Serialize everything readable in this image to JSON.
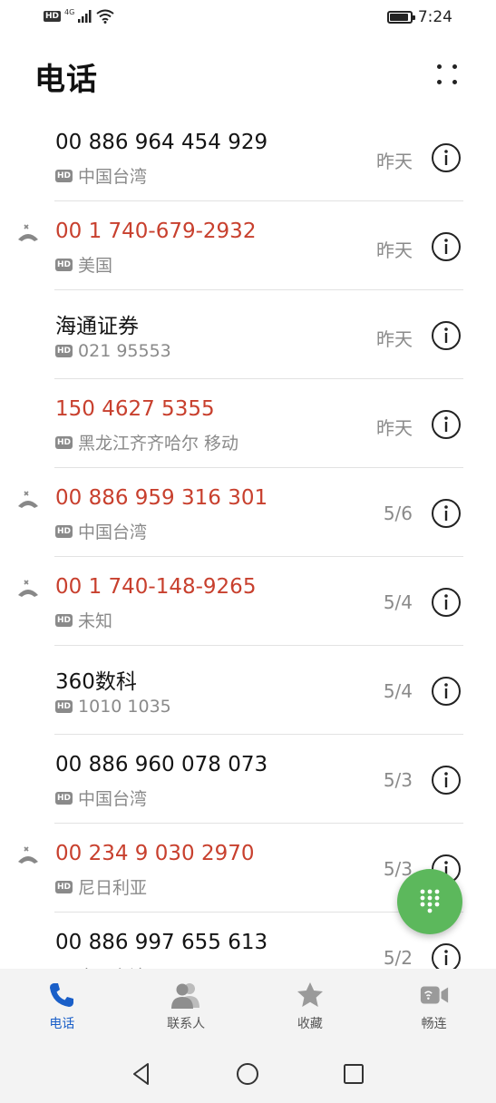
{
  "status_bar": {
    "hd": "HD",
    "network": "4G",
    "time": "7:24",
    "battery_level": 0.9
  },
  "header": {
    "title": "电话"
  },
  "calls": [
    {
      "name": "00 886 964 454 929",
      "location": "中国台湾",
      "date": "昨天",
      "missed": false
    },
    {
      "name": "00 1 740-679-2932",
      "location": "美国",
      "date": "昨天",
      "missed": true
    },
    {
      "name": "海通证券",
      "location": "021 95553",
      "date": "昨天",
      "missed": false
    },
    {
      "name": "150 4627 5355",
      "location": "黑龙江齐齐哈尔 移动",
      "date": "昨天",
      "missed": true
    },
    {
      "name": "00 886 959 316 301",
      "location": "中国台湾",
      "date": "5/6",
      "missed": true
    },
    {
      "name": "00 1 740-148-9265",
      "location": "未知",
      "date": "5/4",
      "missed": true
    },
    {
      "name": "360数科",
      "location": "1010 1035",
      "date": "5/4",
      "missed": false
    },
    {
      "name": "00 886 960 078 073",
      "location": "中国台湾",
      "date": "5/3",
      "missed": false
    },
    {
      "name": "00 234 9 030 2970",
      "location": "尼日利亚",
      "date": "5/3",
      "missed": true
    },
    {
      "name": "00 886 997 655 613",
      "location": "中国台湾",
      "date": "5/2",
      "missed": false
    }
  ],
  "hd_label": "HD",
  "bottom_nav": [
    {
      "label": "电话",
      "icon": "phone-icon",
      "active": true
    },
    {
      "label": "联系人",
      "icon": "contacts-icon",
      "active": false
    },
    {
      "label": "收藏",
      "icon": "star-icon",
      "active": false
    },
    {
      "label": "畅连",
      "icon": "video-call-icon",
      "active": false
    }
  ],
  "colors": {
    "missed": "#c8402e",
    "accent": "#1a5fc8",
    "fab": "#5cb85c"
  }
}
